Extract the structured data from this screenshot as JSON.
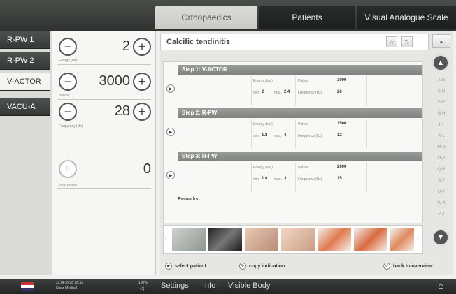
{
  "tabs": [
    "Orthopaedics",
    "Patients",
    "Visual Analogue Scale"
  ],
  "modes": [
    "R-PW 1",
    "R-PW 2",
    "V-ACTOR",
    "VACU-A"
  ],
  "params": [
    {
      "value": "2",
      "label": "Energy (bar)"
    },
    {
      "value": "3000",
      "label": "Pulses"
    },
    {
      "value": "28",
      "label": "Frequency (Hz)"
    }
  ],
  "total": {
    "value": "0",
    "label": "Total pulses"
  },
  "indication": {
    "title": "Calcific tendinitis",
    "steps": [
      {
        "title": "Step 1: V-ACTOR",
        "energy_label": "Energy (bar)",
        "min_label": "min.",
        "min": "2",
        "max_label": "max.",
        "max": "2.4",
        "pulses_label": "Pulses",
        "pulses": "3000",
        "freq_label": "Frequency (Hz)",
        "freq": "20"
      },
      {
        "title": "Step 2: R-PW",
        "energy_label": "Energy (bar)",
        "min_label": "min.",
        "min": "1.8",
        "max_label": "max.",
        "max": "4",
        "pulses_label": "Pulses",
        "pulses": "1500",
        "freq_label": "Frequency (Hz)",
        "freq": "12"
      },
      {
        "title": "Step 3: R-PW",
        "energy_label": "Energy (bar)",
        "min_label": "min.",
        "min": "1.8",
        "max_label": "max.",
        "max": "3",
        "pulses_label": "Pulses",
        "pulses": "2000",
        "freq_label": "Frequency (Hz)",
        "freq": "15"
      }
    ],
    "remarks_label": "Remarks:"
  },
  "alphabet": [
    "A-B",
    "C-D",
    "E-F",
    "G-H",
    "I-J",
    "K-L",
    "M-N",
    "O-P",
    "Q-R",
    "S-T",
    "U-V",
    "W-X",
    "Y-Z"
  ],
  "actions": {
    "select_patient": "select patient",
    "copy_indication": "copy indication",
    "back_to_overview": "back to overview"
  },
  "footer": {
    "datetime": "22.08.2018 18:32",
    "user": "Storz Medical",
    "volume": "100%",
    "settings": "Settings",
    "info": "Info",
    "visible_body": "Visible Body"
  },
  "colors": {
    "accent_dark": "#2f3230",
    "tab_active": "#d2d2ce",
    "step_header": "#8a8d8a"
  }
}
